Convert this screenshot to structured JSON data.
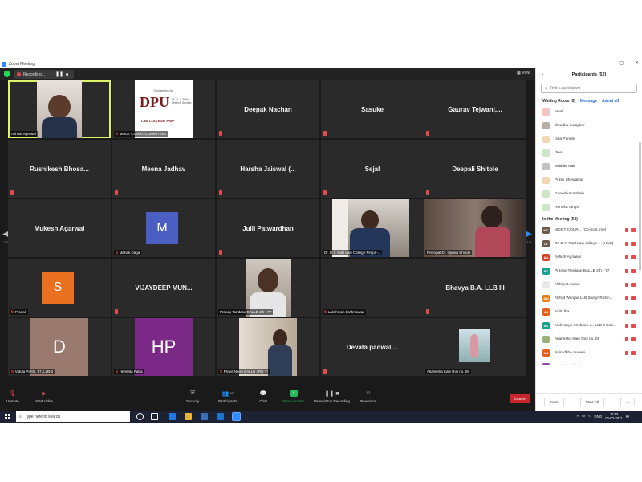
{
  "window": {
    "title": "Zoom Meeting",
    "buttons": [
      "–",
      "▢",
      "✕"
    ]
  },
  "recording": {
    "label": "Recording...",
    "pause": "❚❚",
    "stop": "■"
  },
  "view_label": "View",
  "pages": {
    "left": "1/3",
    "right": "1/3"
  },
  "tiles": [
    {
      "name": "",
      "label": "Ashish Agrawal",
      "type": "video"
    },
    {
      "name": "",
      "label": "MOOT COURT COMMITTEE",
      "type": "banner",
      "banner_top": "Organised by",
      "banner_main": "DPU",
      "banner_side": "Dr. D. Y. Patil Unitech Society",
      "banner_bottom": "LAW COLLEGE, PIMP"
    },
    {
      "name": "Deepak Nachan",
      "label": "",
      "type": "name"
    },
    {
      "name": "Sasuke",
      "label": "",
      "type": "name"
    },
    {
      "name": "Gaurav  Tejwani,...",
      "label": "",
      "type": "name"
    },
    {
      "name": "Rushikesh  Bhosa...",
      "label": "",
      "type": "name"
    },
    {
      "name": "Meena Jadhav",
      "label": "",
      "type": "name"
    },
    {
      "name": "Harsha Jaiswal (...",
      "label": "",
      "type": "name"
    },
    {
      "name": "Sejal",
      "label": "",
      "type": "name"
    },
    {
      "name": "Deepali Shitole",
      "label": "",
      "type": "name"
    },
    {
      "name": "Mukesh Agarwal",
      "label": "",
      "type": "name"
    },
    {
      "name": "M",
      "label": "Mahak Daga",
      "type": "avatar"
    },
    {
      "name": "Juili Patwardhan",
      "label": "",
      "type": "name"
    },
    {
      "name": "",
      "label": "Dr. D.Y. Patil Law College Pimpri-...",
      "type": "video"
    },
    {
      "name": "",
      "label": "Principal Dr. Ujwala Shinde",
      "type": "video"
    },
    {
      "name": "S",
      "label": "Pranali",
      "type": "avatar"
    },
    {
      "name": "VIJAYDEEP  MUN...",
      "label": "",
      "type": "name"
    },
    {
      "name": "",
      "label": "Pranay Tondase BALLB 4th - 77",
      "type": "video"
    },
    {
      "name": "",
      "label": "Lakshman Brahmawar",
      "type": "blank"
    },
    {
      "name": "Bhavya B.A. LLB III",
      "label": "",
      "type": "name"
    },
    {
      "name": "D",
      "label": "Vidula Parthi, 57, LLB-2",
      "type": "avatar"
    },
    {
      "name": "HP",
      "label": "Hemlata Patra",
      "type": "avatar"
    },
    {
      "name": "",
      "label": "Pranit Nerre BALLB 3RD Yr",
      "type": "video"
    },
    {
      "name": "Devata padwal....",
      "label": "",
      "type": "name"
    },
    {
      "name": "",
      "label": "Akanksha Kale Roll no. 06",
      "type": "video"
    }
  ],
  "toolbar": {
    "unmute": "Unmute",
    "start_video": "Start Video",
    "security": "Security",
    "participants": "Participants",
    "participants_count": "60",
    "chat": "Chat",
    "share_screen": "Share Screen",
    "pause_recording": "Pause/Stop Recording",
    "reactions": "Reactions",
    "leave": "Leave"
  },
  "panel": {
    "title": "Participants (52)",
    "search_placeholder": "Find a participant",
    "waiting_room": "Waiting Room (8)",
    "message": "Message",
    "admit_all": "Admit all",
    "waiting": [
      {
        "name": "anjali",
        "initial": "",
        "color": "#f2c6c6"
      },
      {
        "name": "shradha duragkar",
        "initial": "",
        "color": "#b8b0a6"
      },
      {
        "name": "Isha Pareek",
        "initial": "",
        "color": "#f3d7b4"
      },
      {
        "name": "rhea",
        "initial": "",
        "color": "#cfe5c9"
      },
      {
        "name": "Mridula Nair",
        "initial": "",
        "color": "#c2c2c2"
      },
      {
        "name": "Pratik Shewalkar",
        "initial": "",
        "color": "#f3d7b4"
      },
      {
        "name": "Ganesh Bombale",
        "initial": "",
        "color": "#cfe5c9"
      },
      {
        "name": "Renuka Singh",
        "initial": "",
        "color": "#cfe5c9"
      }
    ],
    "in_meeting": "In the Meeting (52)",
    "members": [
      {
        "name": "MOOT COUR... (Co-host, me)",
        "initial": "MC",
        "color": "#6e5a4a"
      },
      {
        "name": "Dr. D.Y. Patil Law college ... (Host)",
        "initial": "Dr",
        "color": "#6e5a4a"
      },
      {
        "name": "Ashish Agrawal",
        "initial": "AA",
        "color": "#d0442e"
      },
      {
        "name": "Pranay Tondase BALLB 4th - 77",
        "initial": "PT",
        "color": "#1ba08e"
      },
      {
        "name": "Abhijeet Aware",
        "initial": "",
        "color": "#e9e9e9"
      },
      {
        "name": "Abhijit Wanjari LLB 2nd yr Roll n...",
        "initial": "AW",
        "color": "#e8801a"
      },
      {
        "name": "Aditi Jha",
        "initial": "AJ",
        "color": "#e0601e"
      },
      {
        "name": "Aishwarya Krishnan a.. LLB 2 Roll...",
        "initial": "AK",
        "color": "#1ba08e"
      },
      {
        "name": "Akanksha Kale Roll no. 06",
        "initial": "",
        "color": "#9bb07a"
      },
      {
        "name": "Anirudhha Sunani",
        "initial": "AS",
        "color": "#e0601e"
      },
      {
        "name": "Anushka Shinde, BALLB 3rd Year",
        "initial": "AS",
        "color": "#8e44ad"
      }
    ],
    "invite": "Invite",
    "mute_all": "Mute All",
    "more": "..."
  },
  "taskbar": {
    "search_placeholder": "Type here to search",
    "lang": "ENG",
    "time": "11:53",
    "date": "02-07-2021"
  }
}
